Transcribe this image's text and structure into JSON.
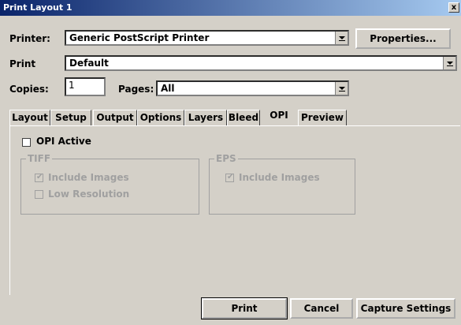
{
  "window": {
    "title": "Print Layout 1",
    "close": "x"
  },
  "printer": {
    "label": "Printer:",
    "value": "Generic PostScript Printer",
    "properties": "Properties..."
  },
  "print": {
    "label": "Print",
    "value": "Default"
  },
  "copies": {
    "label": "Copies:",
    "value": "1"
  },
  "pages": {
    "label": "Pages:",
    "value": "All"
  },
  "tabs": [
    "Layout",
    "Setup",
    "Output",
    "Options",
    "Layers",
    "Bleed",
    "OPI",
    "Preview"
  ],
  "active_tab": "OPI",
  "opi": {
    "active_label": "OPI Active",
    "active_checked": false,
    "tiff": {
      "title": "TIFF",
      "include_images": "Include Images",
      "include_images_checked": true,
      "low_resolution": "Low Resolution",
      "low_resolution_checked": false
    },
    "eps": {
      "title": "EPS",
      "include_images": "Include Images",
      "include_images_checked": true
    }
  },
  "buttons": {
    "print": "Print",
    "cancel": "Cancel",
    "capture": "Capture Settings"
  }
}
